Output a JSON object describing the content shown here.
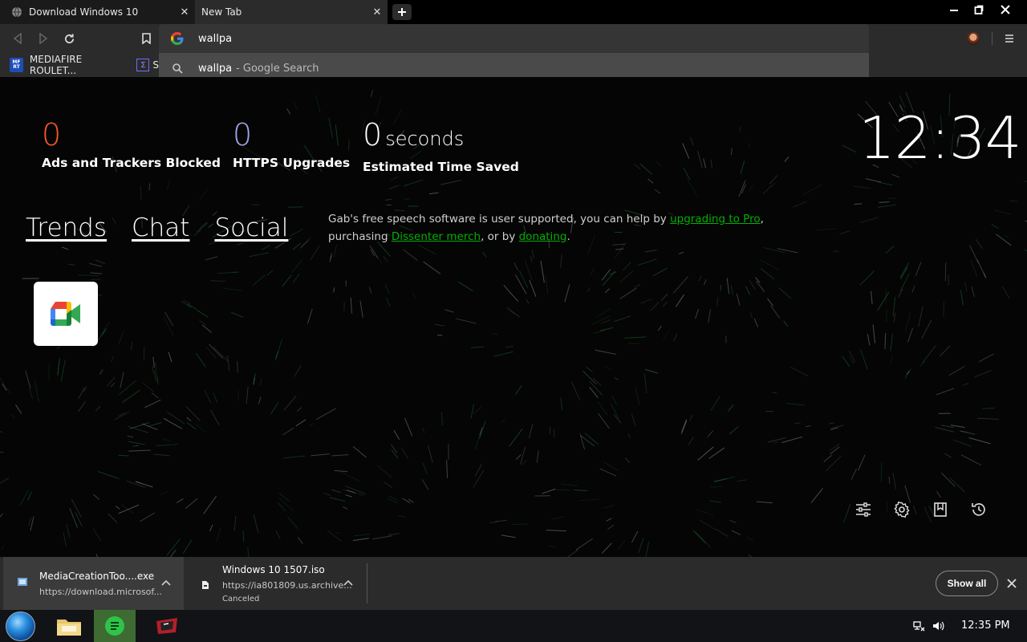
{
  "tabs": [
    {
      "label": "Download Windows 10",
      "favicon": "globe-icon"
    },
    {
      "label": "New Tab",
      "favicon": ""
    }
  ],
  "omnibox": {
    "value": "wallpa",
    "search_engine_icon": "google-icon"
  },
  "suggestion": {
    "query": "wallpa",
    "suffix": "- Google Search"
  },
  "bookmarks": [
    {
      "icon_text": "MF RT",
      "label": "MEDIAFIRE ROULET..."
    },
    {
      "icon_text": "Σ",
      "label": "S"
    }
  ],
  "stats": {
    "ads": {
      "value": "0",
      "caption": "Ads and Trackers Blocked",
      "color": "#fb542b"
    },
    "https": {
      "value": "0",
      "caption": "HTTPS Upgrades",
      "color": "#a0a5eb"
    },
    "time": {
      "value": "0",
      "unit": "seconds",
      "caption": "Estimated Time Saved"
    }
  },
  "clock": "12:34",
  "nav_links": [
    "Trends",
    "Chat",
    "Social"
  ],
  "gab_note": {
    "text1": "Gab's free speech software is user supported, you can help by ",
    "link1": "upgrading to Pro",
    "text2": ", purchasing ",
    "link2": "Dissenter merch",
    "text3": ", or by ",
    "link3": "donating",
    "text4": "."
  },
  "top_site": {
    "name": "Google Meet",
    "icon": "google-meet-icon"
  },
  "page_buttons": [
    "customize-icon",
    "settings-icon",
    "bookmarks-icon",
    "history-icon"
  ],
  "downloads": [
    {
      "name": "MediaCreationToo....exe",
      "url": "https://download.microsof...",
      "status": ""
    },
    {
      "name": "Windows 10 1507.iso",
      "url": "https://ia801809.us.archive...",
      "status": "Canceled"
    }
  ],
  "shelf": {
    "show_all_label": "Show all"
  },
  "taskbar": {
    "time": "12:35 PM"
  },
  "colors": {
    "accent_link": "#00b000",
    "toolbar": "#2b2b2b"
  }
}
